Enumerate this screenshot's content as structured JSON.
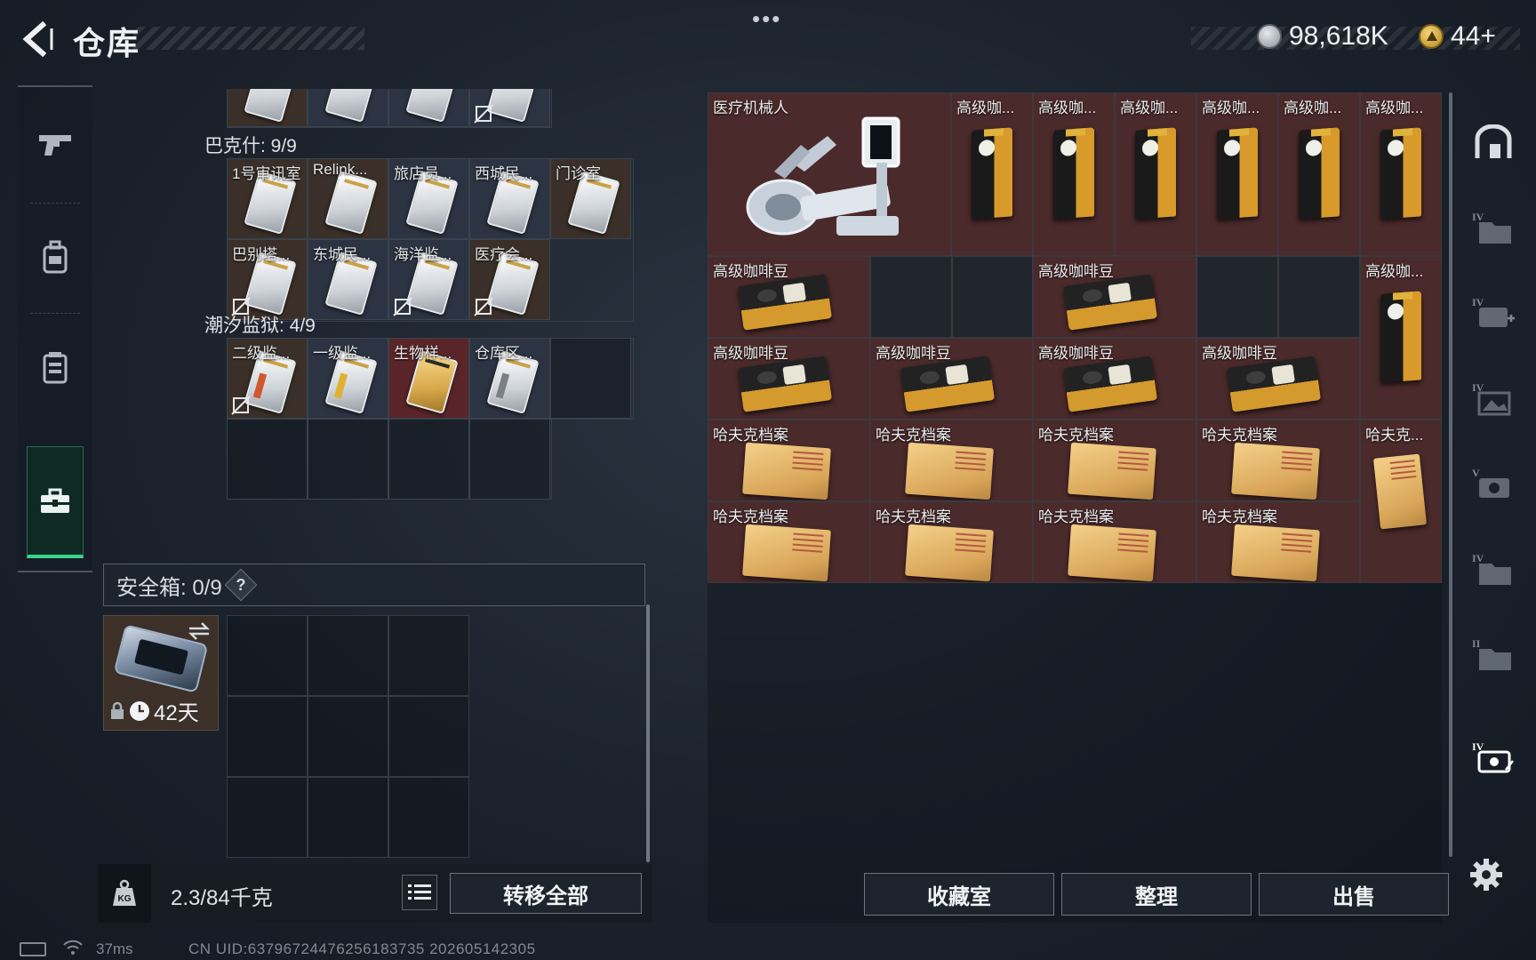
{
  "header": {
    "title": "仓库",
    "currency_silver": "98,618K",
    "currency_gold": "44+"
  },
  "left_rail": {
    "items": [
      {
        "icon": "pistol-icon"
      },
      {
        "icon": "backpack-icon"
      },
      {
        "icon": "vest-icon"
      },
      {
        "icon": "toolbox-icon",
        "active": true
      }
    ]
  },
  "keys": {
    "bakeshi_header": "巴克什: 9/9",
    "bakeshi": [
      "1号审讯室",
      "Relink...",
      "旅店员...",
      "西城民...",
      "门诊室",
      "巴别塔...",
      "东城民...",
      "海洋监...",
      "医疗会..."
    ],
    "chaoxi_header": "潮汐监狱: 4/9",
    "chaoxi": [
      "二级监...",
      "一级监...",
      "生物样...",
      "仓库区..."
    ]
  },
  "safebox": {
    "label": "安全箱: 0/9",
    "help": "?",
    "timer": "42天"
  },
  "footer_left": {
    "weight": "2.3/84千克",
    "transfer_all": "转移全部"
  },
  "stash": {
    "items": {
      "robot": "医疗机械人",
      "coffee_short": "高级咖...",
      "coffee_full": "高级咖啡豆",
      "archive_full": "哈夫克档案",
      "archive_short": "哈夫克..."
    },
    "buttons": {
      "collection": "收藏室",
      "organize": "整理",
      "sell": "出售"
    }
  },
  "status_bar": {
    "ping": "37ms",
    "uid": "CN UID:6379672447625618373​5 202605142305"
  },
  "colors": {
    "accent_green": "#3bd28a",
    "item_red_bg": "#4b2a2b",
    "item_brown_bg": "#3a3029"
  }
}
